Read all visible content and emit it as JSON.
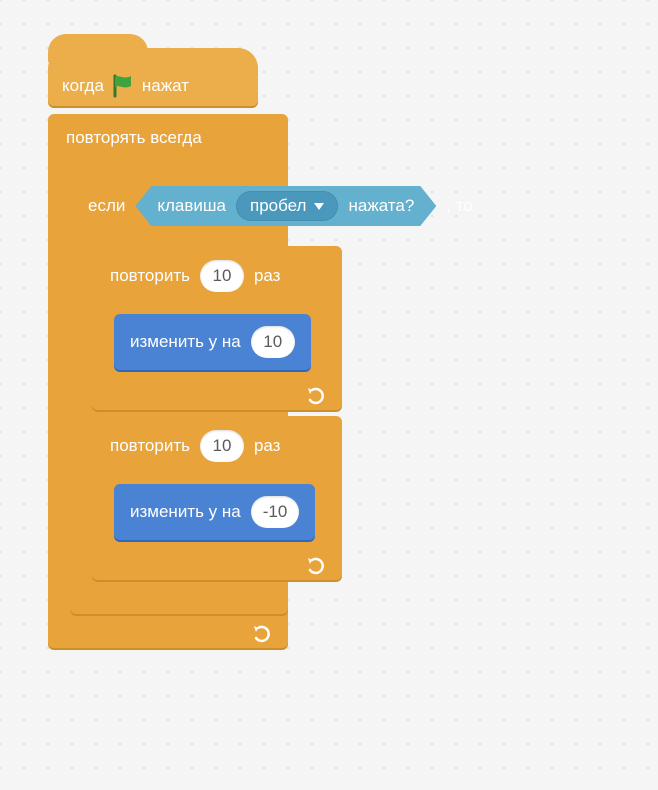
{
  "hat": {
    "when": "когда",
    "clicked": "нажат"
  },
  "forever": {
    "label": "повторять всегда"
  },
  "if": {
    "if": "если",
    "then": ", то"
  },
  "sensing": {
    "key": "клавиша",
    "option": "пробел",
    "pressed": "нажата?"
  },
  "repeat1": {
    "label": "повторить",
    "count": "10",
    "times": "раз"
  },
  "change1": {
    "label": "изменить y на",
    "value": "10"
  },
  "repeat2": {
    "label": "повторить",
    "count": "10",
    "times": "раз"
  },
  "change2": {
    "label": "изменить y на",
    "value": "-10"
  }
}
